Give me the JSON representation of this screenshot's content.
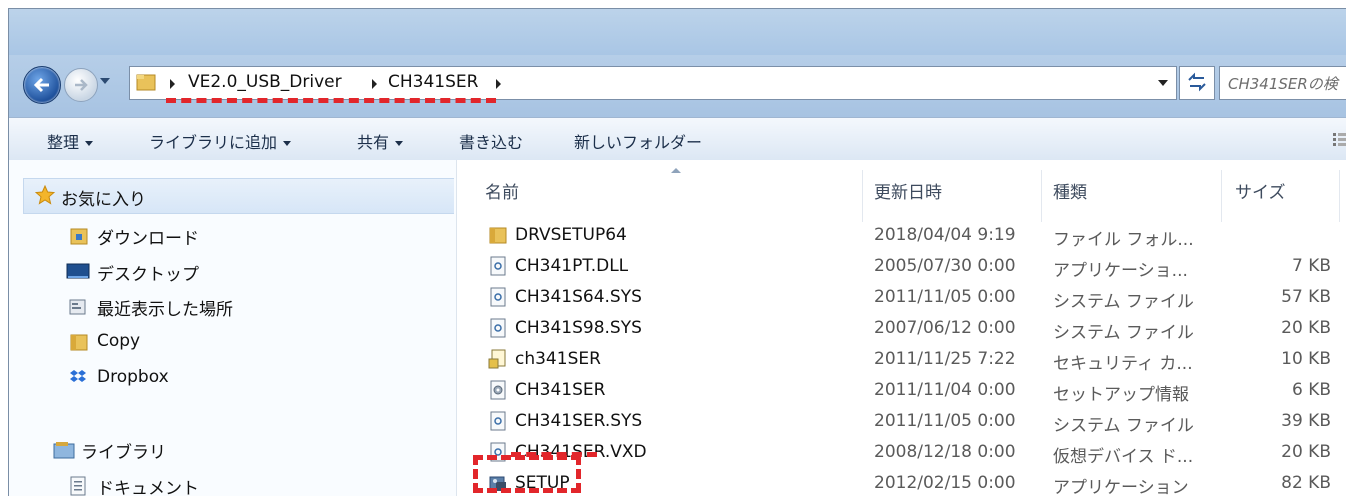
{
  "address": {
    "breadcrumbs": [
      "VE2.0_USB_Driver",
      "CH341SER"
    ],
    "search_placeholder": "CH341SERの検"
  },
  "toolbar": {
    "organize": "整理",
    "add_to_library": "ライブラリに追加",
    "share": "共有",
    "burn": "書き込む",
    "new_folder": "新しいフォルダー"
  },
  "nav": {
    "favorites": "お気に入り",
    "downloads": "ダウンロード",
    "desktop": "デスクトップ",
    "recent": "最近表示した場所",
    "copy": "Copy",
    "dropbox": "Dropbox",
    "libraries": "ライブラリ",
    "documents": "ドキュメント"
  },
  "columns": {
    "name": "名前",
    "date": "更新日時",
    "type": "種類",
    "size": "サイズ"
  },
  "files": [
    {
      "name": "DRVSETUP64",
      "date": "2018/04/04 9:19",
      "type": "ファイル フォル...",
      "size": "",
      "icon": "folder-icon"
    },
    {
      "name": "CH341PT.DLL",
      "date": "2005/07/30 0:00",
      "type": "アプリケーショ...",
      "size": "7 KB",
      "icon": "dll-file-icon"
    },
    {
      "name": "CH341S64.SYS",
      "date": "2011/11/05 0:00",
      "type": "システム ファイル",
      "size": "57 KB",
      "icon": "system-file-icon"
    },
    {
      "name": "CH341S98.SYS",
      "date": "2007/06/12 0:00",
      "type": "システム ファイル",
      "size": "20 KB",
      "icon": "system-file-icon"
    },
    {
      "name": "ch341SER",
      "date": "2011/11/25 7:22",
      "type": "セキュリティ カ...",
      "size": "10 KB",
      "icon": "security-catalog-icon"
    },
    {
      "name": "CH341SER",
      "date": "2011/11/04 0:00",
      "type": "セットアップ情報",
      "size": "6 KB",
      "icon": "setup-info-icon"
    },
    {
      "name": "CH341SER.SYS",
      "date": "2011/11/05 0:00",
      "type": "システム ファイル",
      "size": "39 KB",
      "icon": "system-file-icon"
    },
    {
      "name": "CH341SER.VXD",
      "date": "2008/12/18 0:00",
      "type": "仮想デバイス ド...",
      "size": "20 KB",
      "icon": "system-file-icon"
    },
    {
      "name": "SETUP",
      "date": "2012/02/15 0:00",
      "type": "アプリケーション",
      "size": "82 KB",
      "icon": "setup-exe-icon"
    }
  ],
  "colors": {
    "highlight": "#e2262b",
    "chrome": "#b6cee8"
  }
}
